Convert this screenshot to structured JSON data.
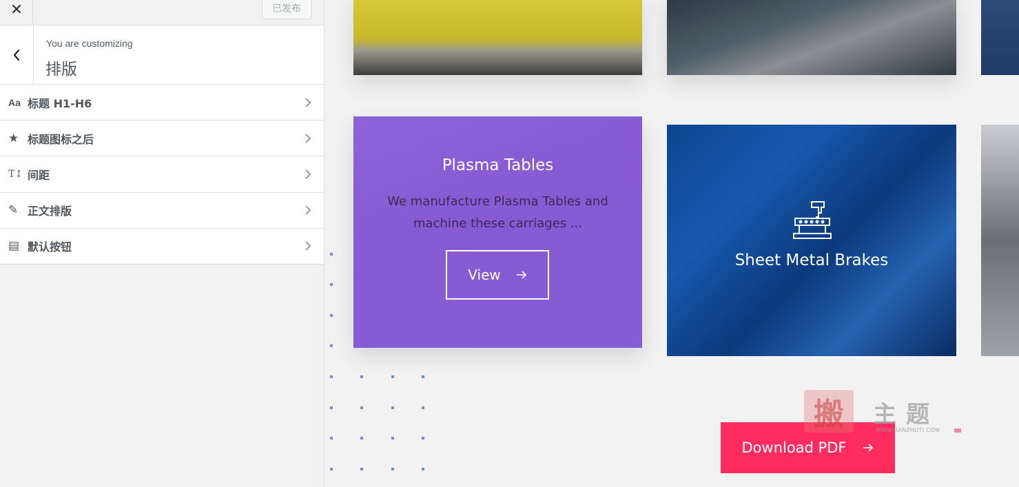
{
  "customizer": {
    "publish_label": "已发布",
    "customizing_label": "You are customizing",
    "section_title": "排版",
    "menu_items": [
      {
        "icon": "text-size-icon",
        "icon_glyph": "Aa",
        "label": "标题 H1-H6"
      },
      {
        "icon": "star-icon",
        "icon_glyph": "★",
        "label": "标题图标之后"
      },
      {
        "icon": "spacing-icon",
        "icon_glyph": "T↕",
        "label": "间距"
      },
      {
        "icon": "edit-icon",
        "icon_glyph": "✎",
        "label": "正文排版"
      },
      {
        "icon": "button-icon",
        "icon_glyph": "▤",
        "label": "默认按钮"
      }
    ]
  },
  "preview": {
    "plasma_card": {
      "title": "Plasma Tables",
      "description": "We manufacture Plasma Tables and machine these carriages ...",
      "button_label": "View",
      "overlay_color": "#8a5ed4"
    },
    "sheet_card": {
      "title": "Sheet Metal Brakes",
      "icon": "machine-icon"
    },
    "download_label": "Download PDF",
    "accent_color": "#ff2d5f",
    "watermark": {
      "seal": "搬",
      "text": "主题",
      "url": "WWW.BANZHUTI.COM"
    }
  }
}
